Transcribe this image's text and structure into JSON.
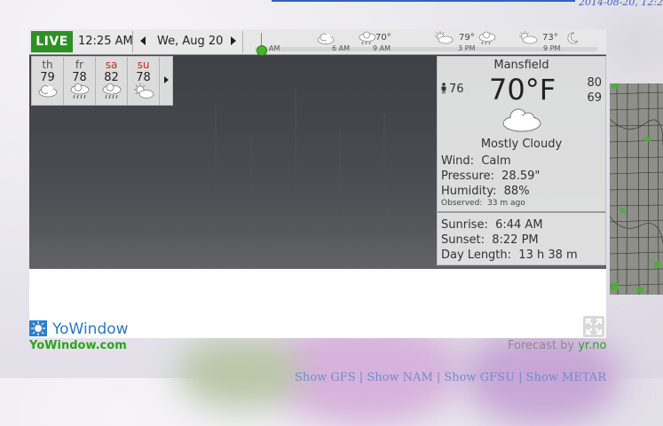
{
  "page": {
    "top_date_fragment": "2014-08-20, 12:2",
    "bottom_links_fragment": "Show GFS | Show NAM | Show GFSU | Show METAR"
  },
  "widget": {
    "live_label": "LIVE",
    "current_time": "12:25 AM",
    "date": "We, Aug 20",
    "timeline": {
      "labels": [
        "AM",
        "6 AM",
        "9 AM",
        "3 PM",
        "9 PM"
      ],
      "temps": [
        "70°",
        "79°",
        "73°"
      ]
    },
    "forecast": [
      {
        "day": "th",
        "temp": "79",
        "icon": "partly-cloudy-icon",
        "weekend": false
      },
      {
        "day": "fr",
        "temp": "78",
        "icon": "rain-cloud-icon",
        "weekend": false
      },
      {
        "day": "sa",
        "temp": "82",
        "icon": "rain-cloud-icon",
        "weekend": true
      },
      {
        "day": "su",
        "temp": "78",
        "icon": "sun-cloud-icon",
        "weekend": true
      }
    ],
    "current": {
      "city": "Mansfield",
      "temperature": "70°F",
      "feels_like": "76",
      "high": "80",
      "low": "69",
      "condition": "Mostly Cloudy",
      "wind_label": "Wind:",
      "wind_value": "Calm",
      "pressure_label": "Pressure:",
      "pressure_value": "28.59\"",
      "humidity_label": "Humidity:",
      "humidity_value": "88%",
      "observed_label": "Observed:",
      "observed_value": "33 m ago",
      "sunrise_label": "Sunrise:",
      "sunrise_value": "6:44 AM",
      "sunset_label": "Sunset:",
      "sunset_value": "8:22 PM",
      "day_length_label": "Day Length:",
      "day_length_value": "13 h 38 m"
    }
  },
  "footer": {
    "brand_name": "YoWindow",
    "brand_url": "YoWindow.com",
    "forecast_by_label": "Forecast by",
    "forecast_source": "yr.no"
  },
  "colors": {
    "live_green": "#2f8f26",
    "weekend_red": "#cc2a1c",
    "brand_blue": "#2b78c5",
    "link_green": "#2aa41d"
  }
}
